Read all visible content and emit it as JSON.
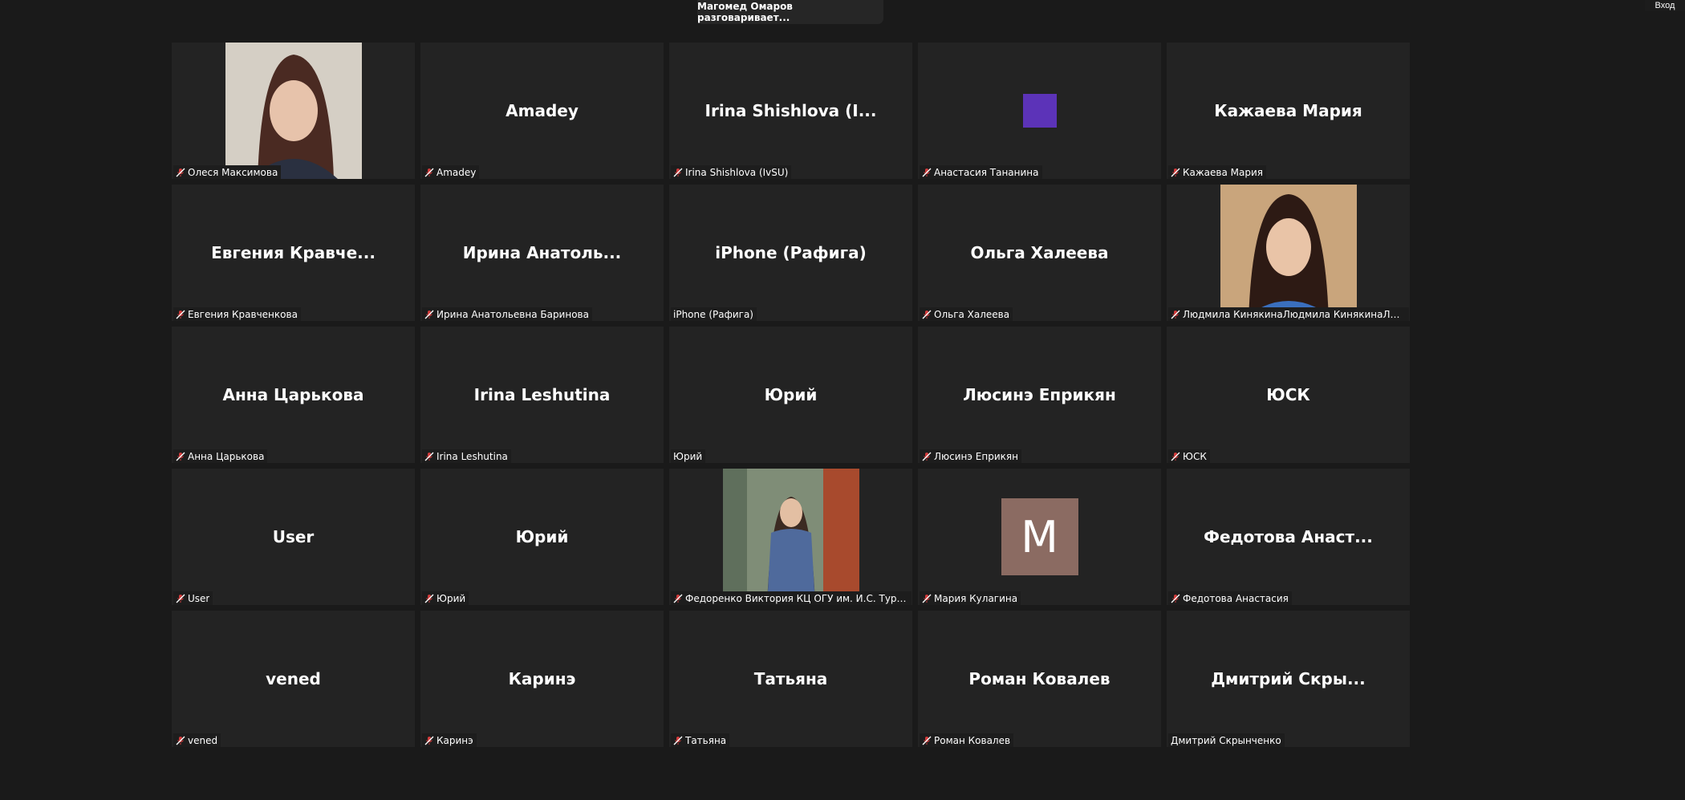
{
  "header": {
    "speaker_banner": "Магомед Омаров разговаривает...",
    "enter_button": "Вход"
  },
  "colors": {
    "background": "#1a1a1a",
    "tile": "#232323",
    "muted_mic": "#d13b3b",
    "avatar_purple": "#5c33b8",
    "avatar_letter_bg": "#8b6b62"
  },
  "participants": [
    {
      "display": "",
      "tag": "Олеся Максимова",
      "muted": true,
      "media": "photo-olesya"
    },
    {
      "display": "Amadey",
      "tag": "Amadey",
      "muted": true
    },
    {
      "display": "Irina Shishlova (I...",
      "tag": "Irina Shishlova (IvSU)",
      "muted": true
    },
    {
      "display": "",
      "tag": "Анастасия Тананина",
      "muted": true,
      "media": "avatar-square-purple"
    },
    {
      "display": "Кажаева Мария",
      "tag": "Кажаева Мария",
      "muted": true
    },
    {
      "display": "Евгения Кравче...",
      "tag": "Евгения Кравченкова",
      "muted": true
    },
    {
      "display": "Ирина Анатоль...",
      "tag": "Ирина Анатольевна Баринова",
      "muted": true
    },
    {
      "display": "iPhone (Рафига)",
      "tag": "iPhone (Рафига)",
      "muted": false
    },
    {
      "display": "Ольга Халеева",
      "tag": "Ольга Халеева",
      "muted": true
    },
    {
      "display": "",
      "tag": "Людмила КинякинаЛюдмила КинякинаЛюдм...",
      "muted": true,
      "media": "photo-lyudmila"
    },
    {
      "display": "Анна Царькова",
      "tag": "Анна Царькова",
      "muted": true
    },
    {
      "display": "Irina Leshutina",
      "tag": "Irina Leshutina",
      "muted": true
    },
    {
      "display": "Юрий",
      "tag": "Юрий",
      "muted": false
    },
    {
      "display": "Люсинэ Еприкян",
      "tag": "Люсинэ Еприкян",
      "muted": true
    },
    {
      "display": "ЮСК",
      "tag": "ЮСК",
      "muted": true
    },
    {
      "display": "User",
      "tag": "User",
      "muted": true
    },
    {
      "display": "Юрий",
      "tag": "Юрий",
      "muted": true
    },
    {
      "display": "",
      "tag": "Федоренко Виктория КЦ ОГУ им. И.С. Турген...",
      "muted": true,
      "media": "photo-fedorenko"
    },
    {
      "display": "",
      "tag": "Мария Кулагина",
      "muted": true,
      "media": "avatar-letter",
      "avatar_letter": "M"
    },
    {
      "display": "Федотова Анаст...",
      "tag": "Федотова Анастасия",
      "muted": true
    },
    {
      "display": "vened",
      "tag": "vened",
      "muted": true
    },
    {
      "display": "Каринэ",
      "tag": "Каринэ",
      "muted": true
    },
    {
      "display": "Татьяна",
      "tag": "Татьяна",
      "muted": true
    },
    {
      "display": "Роман Ковалев",
      "tag": "Роман Ковалев",
      "muted": true
    },
    {
      "display": "Дмитрий Скры...",
      "tag": "Дмитрий Скрынченко",
      "muted": false
    }
  ]
}
